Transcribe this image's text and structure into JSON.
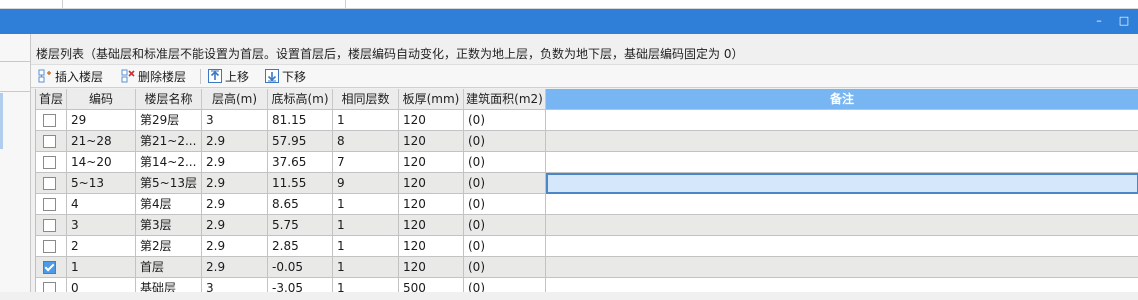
{
  "window": {
    "minimize_glyph": "–",
    "restore_glyph": "□"
  },
  "description": "楼层列表（基础层和标准层不能设置为首层。设置首层后，楼层编码自动变化，正数为地上层，负数为地下层，基础层编码固定为 0）",
  "toolbar": {
    "insert_label": "插入楼层",
    "delete_label": "删除楼层",
    "up_label": "上移",
    "down_label": "下移"
  },
  "table": {
    "headers": {
      "first": "首层",
      "code": "编码",
      "name": "楼层名称",
      "height": "层高(m)",
      "base": "底标高(m)",
      "count": "相同层数",
      "slab": "板厚(mm)",
      "area": "建筑面积(m2)",
      "note": "备注"
    },
    "rows": [
      {
        "first": false,
        "code": "29",
        "name": "第29层",
        "height": "3",
        "base": "81.15",
        "count": "1",
        "slab": "120",
        "area": "(0)",
        "note": ""
      },
      {
        "first": false,
        "code": "21~28",
        "name": "第21~2...",
        "height": "2.9",
        "base": "57.95",
        "count": "8",
        "slab": "120",
        "area": "(0)",
        "note": ""
      },
      {
        "first": false,
        "code": "14~20",
        "name": "第14~2...",
        "height": "2.9",
        "base": "37.65",
        "count": "7",
        "slab": "120",
        "area": "(0)",
        "note": ""
      },
      {
        "first": false,
        "code": "5~13",
        "name": "第5~13层",
        "height": "2.9",
        "base": "11.55",
        "count": "9",
        "slab": "120",
        "area": "(0)",
        "note": ""
      },
      {
        "first": false,
        "code": "4",
        "name": "第4层",
        "height": "2.9",
        "base": "8.65",
        "count": "1",
        "slab": "120",
        "area": "(0)",
        "note": ""
      },
      {
        "first": false,
        "code": "3",
        "name": "第3层",
        "height": "2.9",
        "base": "5.75",
        "count": "1",
        "slab": "120",
        "area": "(0)",
        "note": ""
      },
      {
        "first": false,
        "code": "2",
        "name": "第2层",
        "height": "2.9",
        "base": "2.85",
        "count": "1",
        "slab": "120",
        "area": "(0)",
        "note": ""
      },
      {
        "first": true,
        "code": "1",
        "name": "首层",
        "height": "2.9",
        "base": "-0.05",
        "count": "1",
        "slab": "120",
        "area": "(0)",
        "note": ""
      },
      {
        "first": false,
        "code": "0",
        "name": "基础层",
        "height": "3",
        "base": "-3.05",
        "count": "1",
        "slab": "500",
        "area": "(0)",
        "note": ""
      }
    ]
  },
  "colors": {
    "titlebar": "#2f7fd9",
    "note_header": "#77b6f2",
    "row_alt": "#e9eae8",
    "selection": "#d5e8fb"
  },
  "icons": [
    "insert-floor-icon",
    "delete-floor-icon",
    "move-up-icon",
    "move-down-icon",
    "checkbox-checked-icon"
  ]
}
